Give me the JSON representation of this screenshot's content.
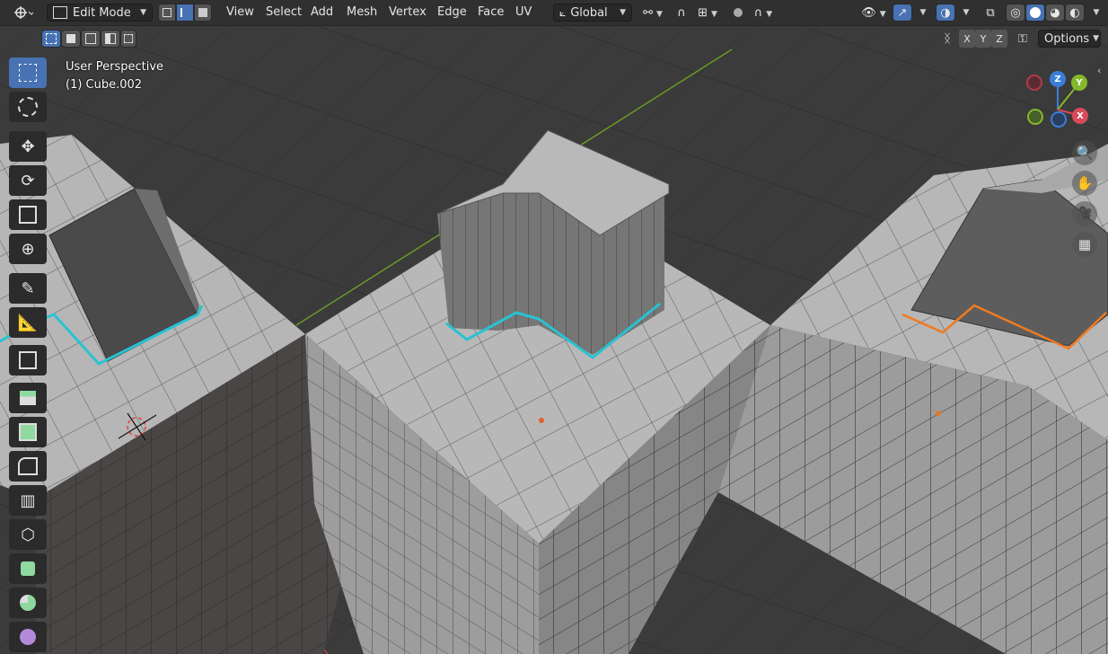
{
  "header": {
    "mode": "Edit Mode",
    "menus": [
      "View",
      "Select",
      "Add",
      "Mesh",
      "Vertex",
      "Edge",
      "Face",
      "UV"
    ],
    "orientation": "Global",
    "options": "Options",
    "axes": [
      "X",
      "Y",
      "Z"
    ]
  },
  "viewport": {
    "view_name": "User Perspective",
    "object_name": "(1) Cube.002"
  },
  "gizmo": {
    "x": "X",
    "y": "Y",
    "z": "Z"
  },
  "toolbar": {
    "tools": [
      "select-box",
      "cursor",
      "move",
      "rotate",
      "scale",
      "transform",
      "annotate",
      "measure",
      "add-cube",
      "extrude-region",
      "inset-faces",
      "bevel",
      "loop-cut",
      "knife",
      "poly-build",
      "spin",
      "smooth"
    ],
    "active_tool": "select-box"
  },
  "colors": {
    "background": "#3a3a3a",
    "accent": "#4772b3",
    "selection_cyan": "#28c3d2",
    "selection_orange": "#f07a20",
    "axis_x": "#d84a5a",
    "axis_y": "#84b82a",
    "axis_z": "#3a7ed8"
  }
}
